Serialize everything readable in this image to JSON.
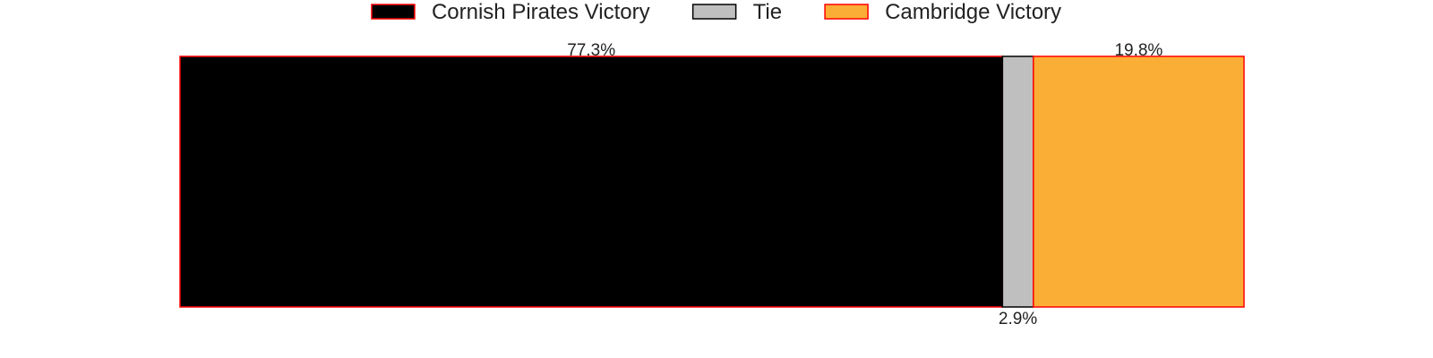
{
  "chart_data": {
    "type": "bar",
    "orientation": "horizontal-stacked",
    "series": [
      {
        "name": "Cornish Pirates Victory",
        "value": 77.3,
        "label": "77.3%",
        "color": "#000000",
        "edge_color": "#ff0000"
      },
      {
        "name": "Tie",
        "value": 2.9,
        "label": "2.9%",
        "color": "#bfbfbf",
        "edge_color": "#000000"
      },
      {
        "name": "Cambridge Victory",
        "value": 19.8,
        "label": "19.8%",
        "color": "#fbae36",
        "edge_color": "#ff0000"
      }
    ],
    "total": 100,
    "legend_position": "top-center",
    "grid": false,
    "axes_visible": false,
    "label_placement": [
      "above",
      "below",
      "above"
    ]
  }
}
